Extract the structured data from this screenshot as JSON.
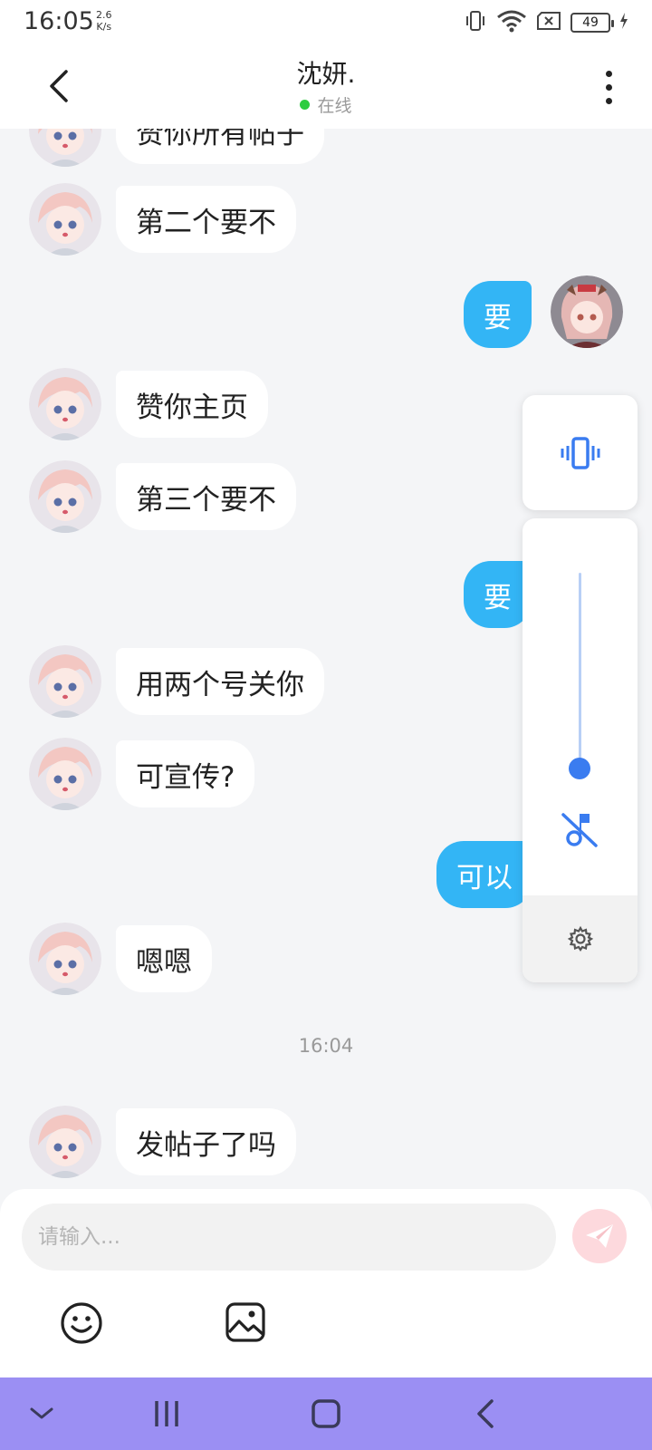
{
  "status_bar": {
    "time": "16:05",
    "net_speed_value": "2.6",
    "net_speed_unit": "K/s",
    "battery": "49",
    "icons": [
      "vibrate-icon",
      "wifi-icon",
      "no-sim-icon",
      "battery-icon",
      "charging-icon"
    ]
  },
  "header": {
    "title": "沈妍.",
    "status": "在线",
    "status_color": "#2ecc40"
  },
  "messages": [
    {
      "side": "in",
      "text": "赞你所有帖子"
    },
    {
      "side": "in",
      "text": "第二个要不"
    },
    {
      "side": "out",
      "text": "要"
    },
    {
      "side": "in",
      "text": "赞你主页"
    },
    {
      "side": "in",
      "text": "第三个要不"
    },
    {
      "side": "out",
      "text": "要"
    },
    {
      "side": "in",
      "text": "用两个号关你"
    },
    {
      "side": "in",
      "text": "可宣传?"
    },
    {
      "side": "out",
      "text": "可以"
    },
    {
      "side": "in",
      "text": "嗯嗯"
    },
    {
      "side": "in",
      "text": "发帖子了吗"
    }
  ],
  "timestamp": "16:04",
  "volume_panel": {
    "level": 0.1,
    "icons": [
      "vibrate-mode-icon",
      "media-muted-icon",
      "settings-icon"
    ],
    "accent": "#3a7cf0"
  },
  "composer": {
    "placeholder": "请输入...",
    "send_color": "#fdd9dd",
    "icons": [
      "emoji-icon",
      "image-icon",
      "send-icon"
    ]
  },
  "colors": {
    "outgoing_bubble": "#33b5f5",
    "incoming_bubble": "#ffffff",
    "nav_bar": "#9b8ff3",
    "chat_background": "#f4f5f7"
  },
  "nav_bar": {
    "icons": [
      "hide-keyboard-icon",
      "recents-icon",
      "home-icon",
      "back-icon"
    ]
  }
}
